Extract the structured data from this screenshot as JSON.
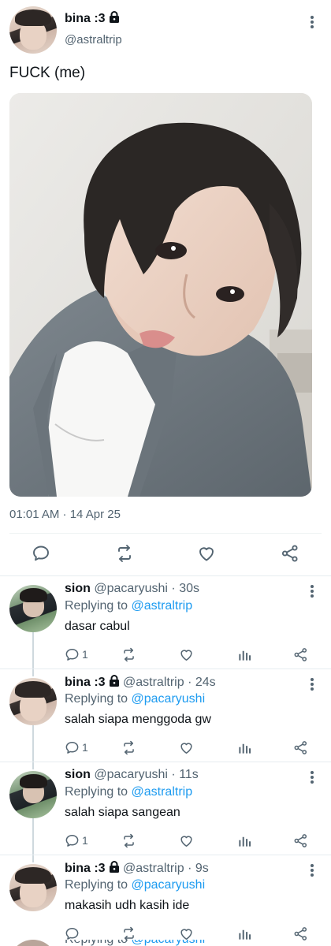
{
  "main_tweet": {
    "author": {
      "display_name": "bina :3",
      "handle": "@astraltrip",
      "protected": true
    },
    "text": "FUCK (me)",
    "timestamp": "01:01 AM · 14 Apr 25",
    "actions": [
      "reply",
      "retweet",
      "like",
      "share"
    ]
  },
  "replies": [
    {
      "display_name": "sion",
      "handle": "@pacaryushi",
      "time": "· 30s",
      "replying_prefix": "Replying to",
      "replying_to": "@astraltrip",
      "text": "dasar cabul",
      "reply_count": "1",
      "protected": false
    },
    {
      "display_name": "bina :3",
      "handle": "@astraltrip",
      "time": "· 24s",
      "replying_prefix": "Replying to",
      "replying_to": "@pacaryushi",
      "text": "salah siapa menggoda gw",
      "reply_count": "1",
      "protected": true
    },
    {
      "display_name": "sion",
      "handle": "@pacaryushi",
      "time": "· 11s",
      "replying_prefix": "Replying to",
      "replying_to": "@astraltrip",
      "text": "salah siapa sangean",
      "reply_count": "1",
      "protected": false
    },
    {
      "display_name": "bina :3",
      "handle": "@astraltrip",
      "time": "· 9s",
      "replying_prefix": "Replying to",
      "replying_to": "@pacaryushi",
      "text": "makasih udh kasih ide",
      "reply_count": "",
      "protected": true
    }
  ],
  "cutoff_reply": {
    "replying_prefix": "Replying to",
    "replying_to": "@pacaryushi"
  },
  "colors": {
    "link": "#1d9bf0",
    "secondary_text": "#536471",
    "primary_text": "#0f1419",
    "divider": "#eff3f4"
  },
  "icons": [
    "lock-icon",
    "more-icon",
    "reply-icon",
    "retweet-icon",
    "like-icon",
    "share-icon",
    "analytics-icon"
  ]
}
